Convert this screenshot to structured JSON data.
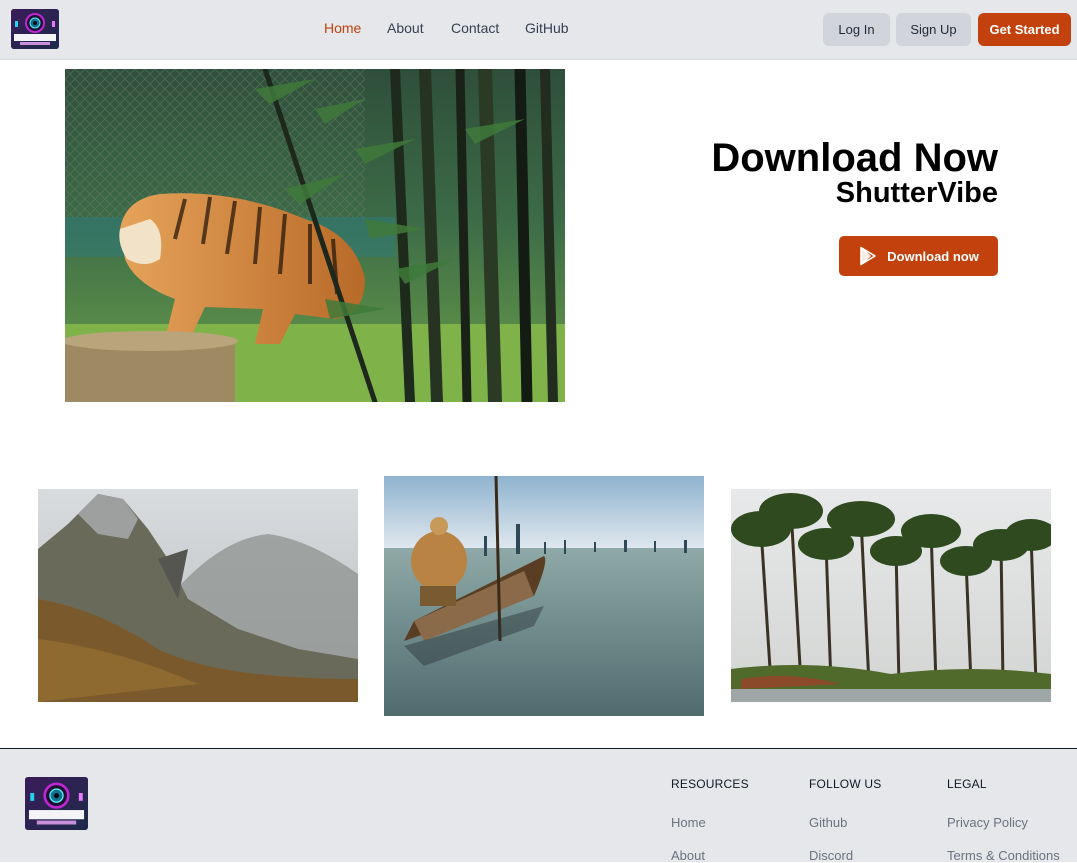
{
  "brand": {
    "logo_text": "SHUTTERVIBE",
    "logo_tagline": "LET'S CAPTURE MAGIC",
    "logo_icon": "camera-lens-icon"
  },
  "nav": {
    "links": [
      {
        "label": "Home",
        "active": true
      },
      {
        "label": "About",
        "active": false
      },
      {
        "label": "Contact",
        "active": false
      },
      {
        "label": "GitHub",
        "active": false
      }
    ],
    "login_label": "Log In",
    "signup_label": "Sign Up",
    "get_started_label": "Get Started"
  },
  "hero": {
    "title": "Download Now",
    "subtitle": "ShutterVibe",
    "download_label": "Download now",
    "download_icon": "play-store-icon"
  },
  "footer": {
    "columns": [
      {
        "heading": "RESOURCES",
        "links": [
          "Home",
          "About"
        ]
      },
      {
        "heading": "FOLLOW US",
        "links": [
          "Github",
          "Discord"
        ]
      },
      {
        "heading": "LEGAL",
        "links": [
          "Privacy Policy",
          "Terms & Conditions"
        ]
      }
    ]
  },
  "colors": {
    "accent": "#c2410c",
    "nav_bg": "#e5e7eb",
    "button_light": "#d1d5db",
    "link_gray": "#6b7280"
  }
}
